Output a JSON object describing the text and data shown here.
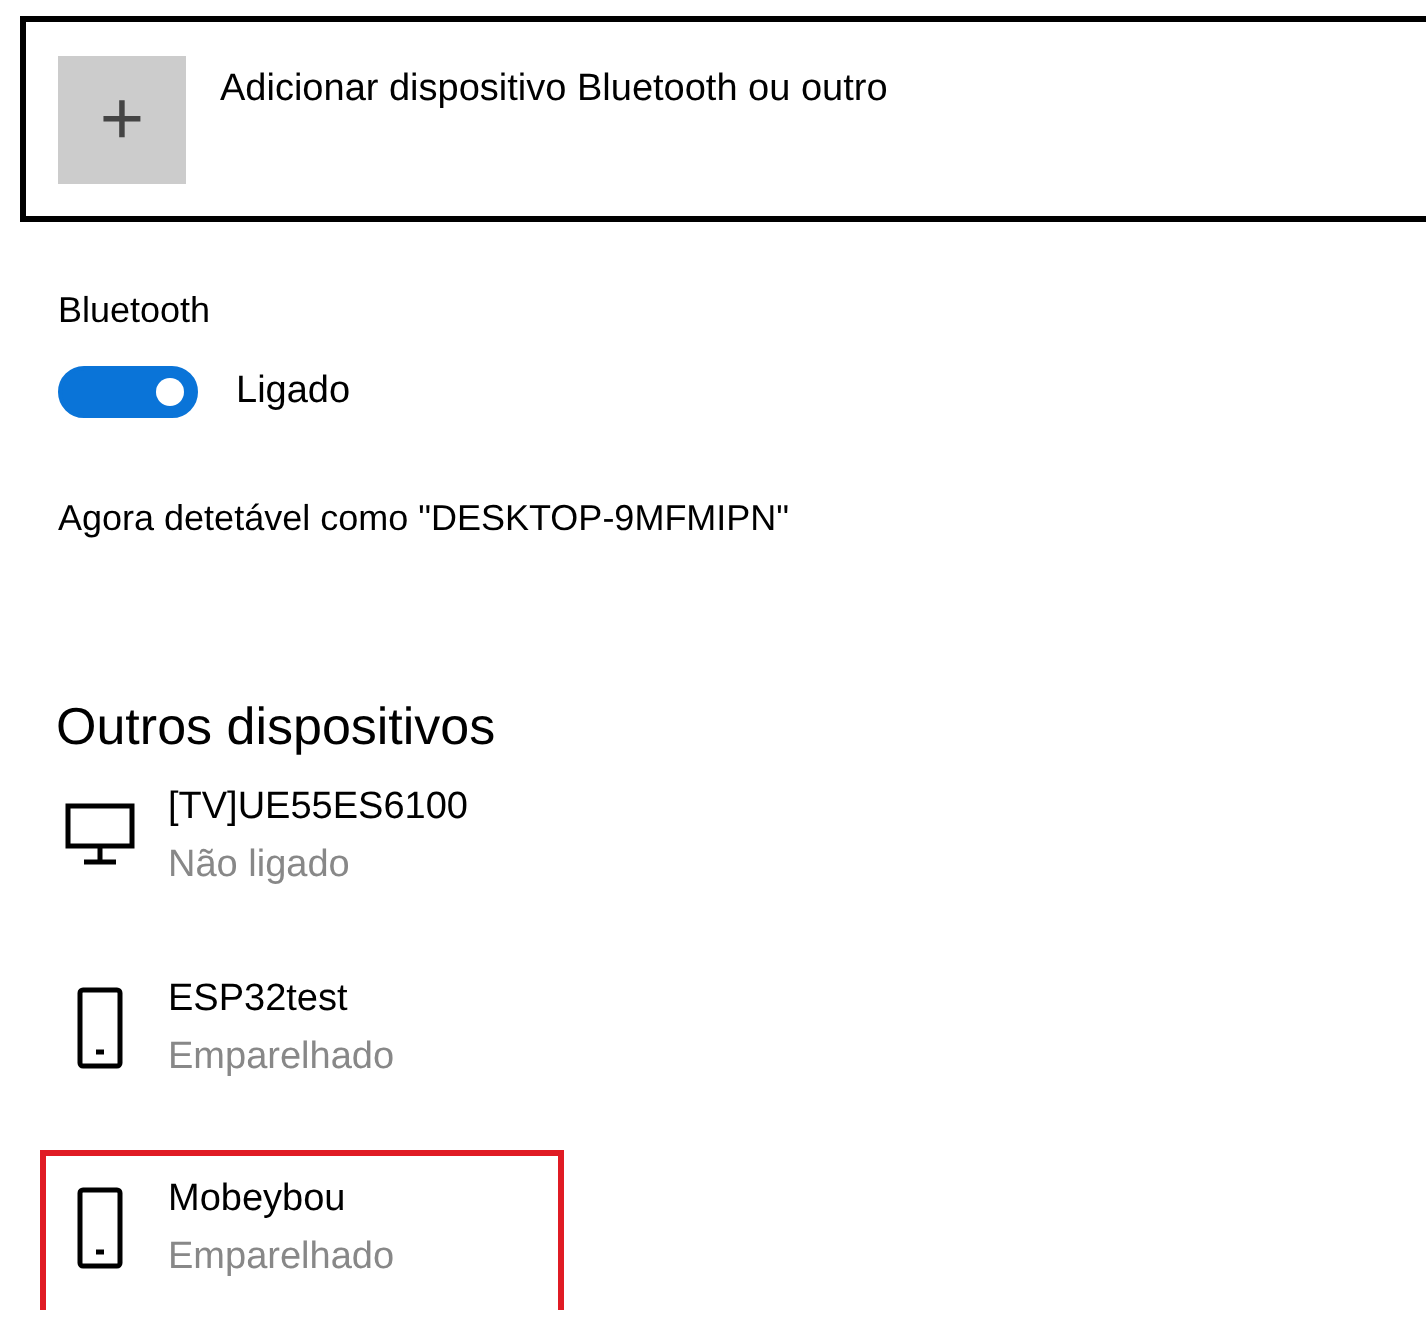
{
  "add_device": {
    "icon": "+",
    "label": "Adicionar dispositivo Bluetooth ou outro"
  },
  "bluetooth": {
    "label": "Bluetooth",
    "on": true,
    "state_label": "Ligado",
    "discoverable": "Agora detetável como \"DESKTOP-9MFMIPN\""
  },
  "other_devices": {
    "title": "Outros dispositivos",
    "items": [
      {
        "kind": "tv",
        "name": "[TV]UE55ES6100",
        "status": "Não ligado",
        "highlighted": false
      },
      {
        "kind": "phone",
        "name": "ESP32test",
        "status": "Emparelhado",
        "highlighted": false
      },
      {
        "kind": "phone",
        "name": "Mobeybou",
        "status": "Emparelhado",
        "highlighted": true
      }
    ]
  }
}
